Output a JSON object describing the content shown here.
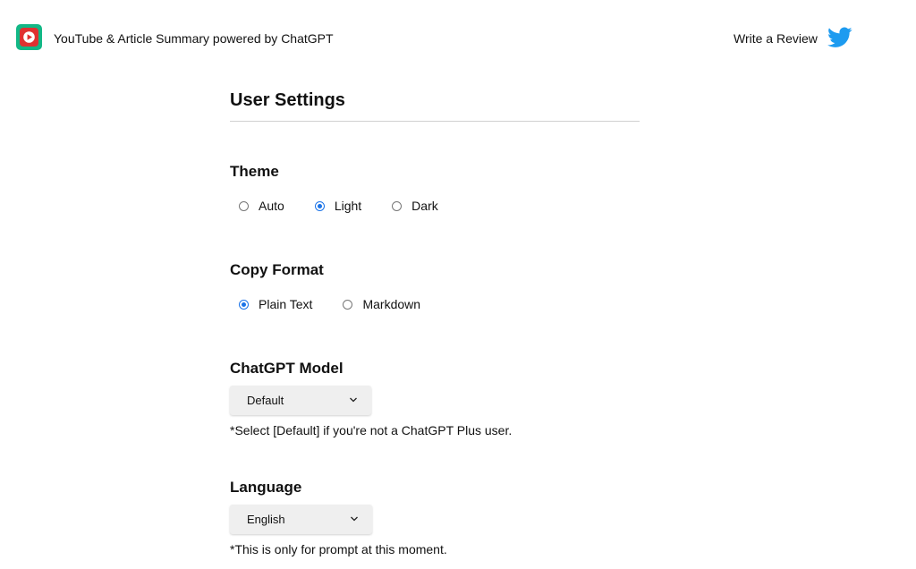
{
  "header": {
    "app_title": "YouTube & Article Summary powered by ChatGPT",
    "logo_icon": "play-logo-icon",
    "review_label": "Write a Review",
    "social_icon": "twitter-icon",
    "logo_colors": {
      "outer": "#12b886",
      "inner": "#e03131"
    },
    "twitter_color": "#1d9bf0"
  },
  "settings": {
    "title": "User Settings",
    "theme": {
      "title": "Theme",
      "options": [
        "Auto",
        "Light",
        "Dark"
      ],
      "selected": "Light"
    },
    "copy_format": {
      "title": "Copy Format",
      "options": [
        "Plain Text",
        "Markdown"
      ],
      "selected": "Plain Text"
    },
    "model": {
      "title": "ChatGPT Model",
      "selected_value": "Default",
      "note": "*Select [Default] if you're not a ChatGPT Plus user."
    },
    "language": {
      "title": "Language",
      "selected_value": "English",
      "note": "*This is only for prompt at this moment."
    }
  },
  "accent_color": "#1a73e8"
}
